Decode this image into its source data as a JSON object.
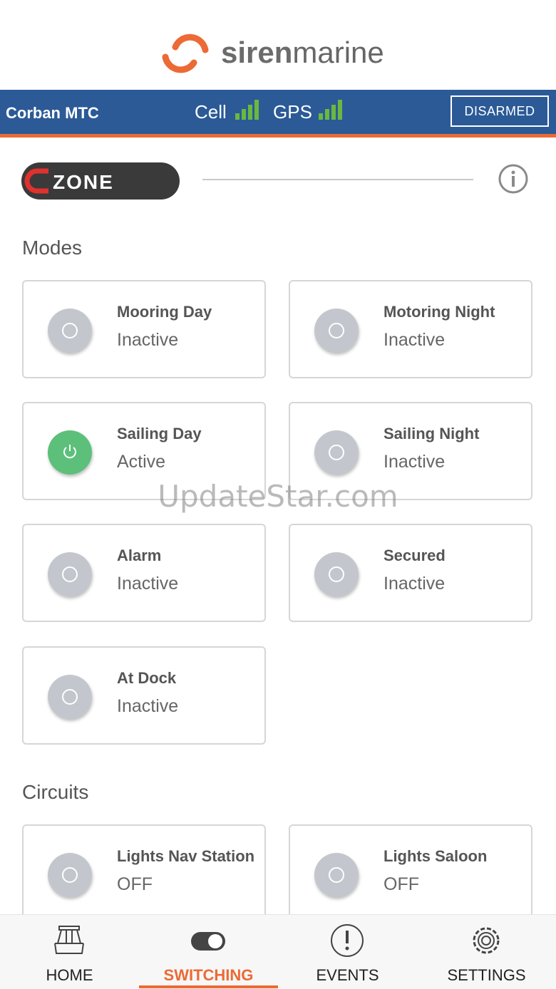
{
  "brand": {
    "name_bold": "siren",
    "name_regular": "marine",
    "accent": "#ec6a35"
  },
  "status": {
    "boat_name": "Corban MTC",
    "cell_label": "Cell",
    "gps_label": "GPS",
    "arm_state": "DISARMED",
    "bar_color": "#2b5a97",
    "signal_color": "#6ab840"
  },
  "czone": {
    "logo": "CZONE",
    "info_icon": "info-icon"
  },
  "modes": {
    "title": "Modes",
    "items": [
      {
        "name": "Mooring Day",
        "state": "Inactive",
        "active": false
      },
      {
        "name": "Motoring Night",
        "state": "Inactive",
        "active": false
      },
      {
        "name": "Sailing Day",
        "state": "Active",
        "active": true
      },
      {
        "name": "Sailing Night",
        "state": "Inactive",
        "active": false
      },
      {
        "name": "Alarm",
        "state": "Inactive",
        "active": false
      },
      {
        "name": "Secured",
        "state": "Inactive",
        "active": false
      },
      {
        "name": "At Dock",
        "state": "Inactive",
        "active": false
      }
    ]
  },
  "circuits": {
    "title": "Circuits",
    "items": [
      {
        "name": "Lights Nav Station",
        "state": "OFF",
        "active": false
      },
      {
        "name": "Lights Saloon",
        "state": "OFF",
        "active": false
      }
    ]
  },
  "watermark": "UpdateStar.com",
  "nav": {
    "items": [
      {
        "label": "HOME",
        "icon": "boat-icon"
      },
      {
        "label": "SWITCHING",
        "icon": "toggle-icon",
        "active": true
      },
      {
        "label": "EVENTS",
        "icon": "alert-icon"
      },
      {
        "label": "SETTINGS",
        "icon": "gear-icon"
      }
    ]
  }
}
